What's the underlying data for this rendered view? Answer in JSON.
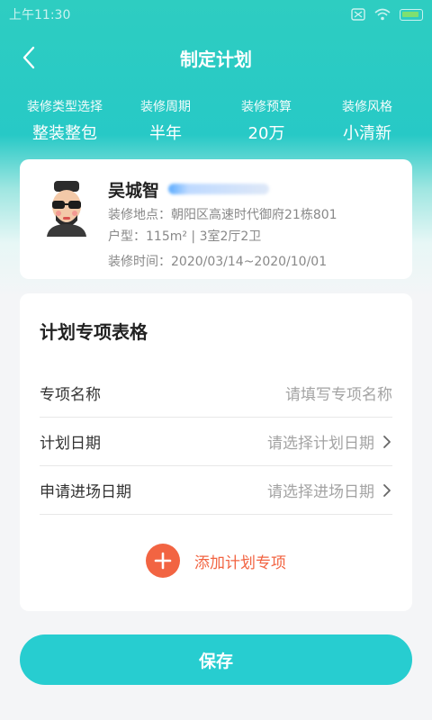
{
  "status_bar": {
    "time": "上午11:30"
  },
  "nav": {
    "title": "制定计划"
  },
  "stats": [
    {
      "label": "装修类型选择",
      "value": "整装整包"
    },
    {
      "label": "装修周期",
      "value": "半年"
    },
    {
      "label": "装修预算",
      "value": "20万"
    },
    {
      "label": "装修风格",
      "value": "小清新"
    }
  ],
  "user": {
    "name": "吴城智",
    "address": "装修地点：朝阳区高速时代御府21栋801",
    "layout": "户型：115m² | 3室2厅2卫",
    "period": "装修时间：2020/03/14~2020/10/01"
  },
  "plan": {
    "title": "计划专项表格",
    "rows": [
      {
        "label": "专项名称",
        "placeholder": "请填写专项名称",
        "has_arrow": false
      },
      {
        "label": "计划日期",
        "placeholder": "请选择计划日期",
        "has_arrow": true
      },
      {
        "label": "申请进场日期",
        "placeholder": "请选择进场日期",
        "has_arrow": true
      }
    ],
    "add_label": "添加计划专项"
  },
  "save_label": "保存",
  "colors": {
    "primary": "#27cdd0",
    "accent": "#f26442"
  }
}
